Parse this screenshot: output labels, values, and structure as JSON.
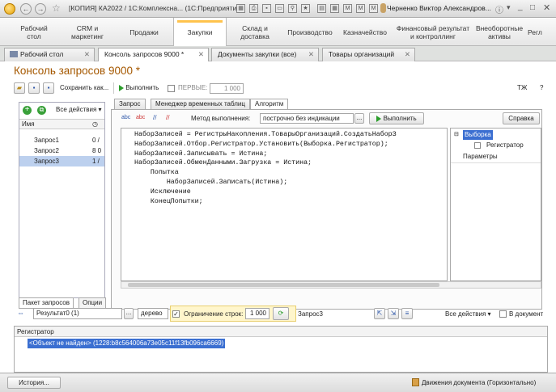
{
  "window": {
    "title": "[КОПИЯ] КА2022 / 1С:Комплексна... (1С:Предприятие)",
    "user": "Черненко Виктор Александров..."
  },
  "sections": [
    {
      "label": "Рабочий\nстол"
    },
    {
      "label": "CRM и\nмаркетинг"
    },
    {
      "label": "Продажи"
    },
    {
      "label": "Закупки"
    },
    {
      "label": "Склад и\nдоставка"
    },
    {
      "label": "Производство"
    },
    {
      "label": "Казначейство"
    },
    {
      "label": "Финансовый результат\nи контроллинг"
    },
    {
      "label": "Внеоборотные\nактивы"
    },
    {
      "label": "Регл"
    }
  ],
  "open_tabs": [
    {
      "label": "Рабочий стол"
    },
    {
      "label": "Консоль запросов 9000 *"
    },
    {
      "label": "Документы закупки (все)"
    },
    {
      "label": "Товары организаций"
    }
  ],
  "form": {
    "title": "Консоль запросов 9000 *",
    "save_as": "Сохранить как...",
    "execute": "Выполнить",
    "first_label": "ПЕРВЫЕ:",
    "first_value": "1 000",
    "tj": "ТЖ",
    "help_mark": "?"
  },
  "query_list": {
    "all_actions": "Все действия",
    "column_name": "Имя",
    "items": [
      {
        "name": "Запрос1",
        "value": "0 /"
      },
      {
        "name": "Запрос2",
        "value": "8 0"
      },
      {
        "name": "Запрос3",
        "value": "1 /"
      }
    ],
    "tab_package": "Пакет запросов",
    "tab_options": "Опции"
  },
  "right_tabs": [
    {
      "label": "Запрос"
    },
    {
      "label": "Менеджер временных таблиц"
    },
    {
      "label": "Алгоритм"
    }
  ],
  "algorithm": {
    "method_label": "Метод выполнения:",
    "method_value": "построчно без индикации",
    "execute": "Выполнить",
    "help": "Справка",
    "code": "НаборЗаписей = РегистрыНакопления.ТоварыОрганизаций.СоздатьНаборЗ\nНаборЗаписей.Отбор.Регистратор.Установить(Выборка.Регистратор);\nНаборЗаписей.Записывать = Истина;\nНаборЗаписей.ОбменДанными.Загрузка = Истина;\n    Попытка\n        НаборЗаписей.Записать(Истина);\n    Исключение\n    КонецПопытки;",
    "tree": {
      "root": "Выборка",
      "child": "Регистратор",
      "params": "Параметры"
    }
  },
  "result": {
    "result_field": "Результат0 (1)",
    "view_field": "дерево",
    "limit_label": "Ограничение строк:",
    "limit_value": "1 000",
    "query_name": "Запрос3",
    "all_actions": "Все действия",
    "in_document": "В документ",
    "column": "Регистратор",
    "row_value": "<Объект не найден> (1228:b8c564006a73e05c11f13fb096ca6669)"
  },
  "status": {
    "history": "История...",
    "movements": "Движения документа (Горизонтально)"
  },
  "colors": {
    "accent_orange": "#ffc34d",
    "title_brown": "#a55800",
    "selection_blue": "#3b6fd1"
  }
}
